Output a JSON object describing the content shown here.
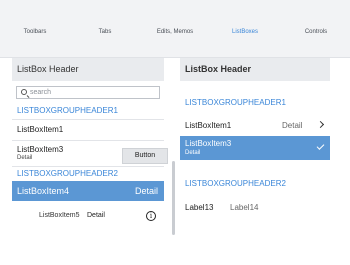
{
  "tabs": [
    {
      "label": "Toolbars"
    },
    {
      "label": "Tabs"
    },
    {
      "label": "Edits, Memos"
    },
    {
      "label": "ListBoxes"
    },
    {
      "label": "Controls"
    }
  ],
  "active_tab_index": 3,
  "colors": {
    "accent": "#3a86d8",
    "selection": "#5b97d4",
    "header_bg": "#e9ebee",
    "tabbar_bg": "#f2f3f5"
  },
  "left_listbox": {
    "header": "ListBox Header",
    "search": {
      "placeholder": "search",
      "icon": "search-icon"
    },
    "group1": "LISTBOXGROUPHEADER1",
    "item1": {
      "title": "ListBoxItem1"
    },
    "item3": {
      "title": "ListBoxItem3",
      "detail": "Detail",
      "button_label": "Button"
    },
    "group2": "LISTBOXGROUPHEADER2",
    "item4": {
      "title": "ListBoxItem4",
      "detail": "Detail",
      "selected": true
    },
    "item5": {
      "title": "ListBoxItem5",
      "detail": "Detail",
      "icon": "info-icon"
    }
  },
  "right_listbox": {
    "header": "ListBox Header",
    "group1": "LISTBOXGROUPHEADER1",
    "item1": {
      "title": "ListBoxItem1",
      "detail": "Detail",
      "icon": "chevron-right-icon"
    },
    "item3": {
      "title": "ListBoxItem3",
      "detail": "Detail",
      "selected": true,
      "icon": "checkmark-icon"
    },
    "group2": "LISTBOXGROUPHEADER2",
    "labels_row": {
      "label1": "Label13",
      "label2": "Label14"
    }
  }
}
